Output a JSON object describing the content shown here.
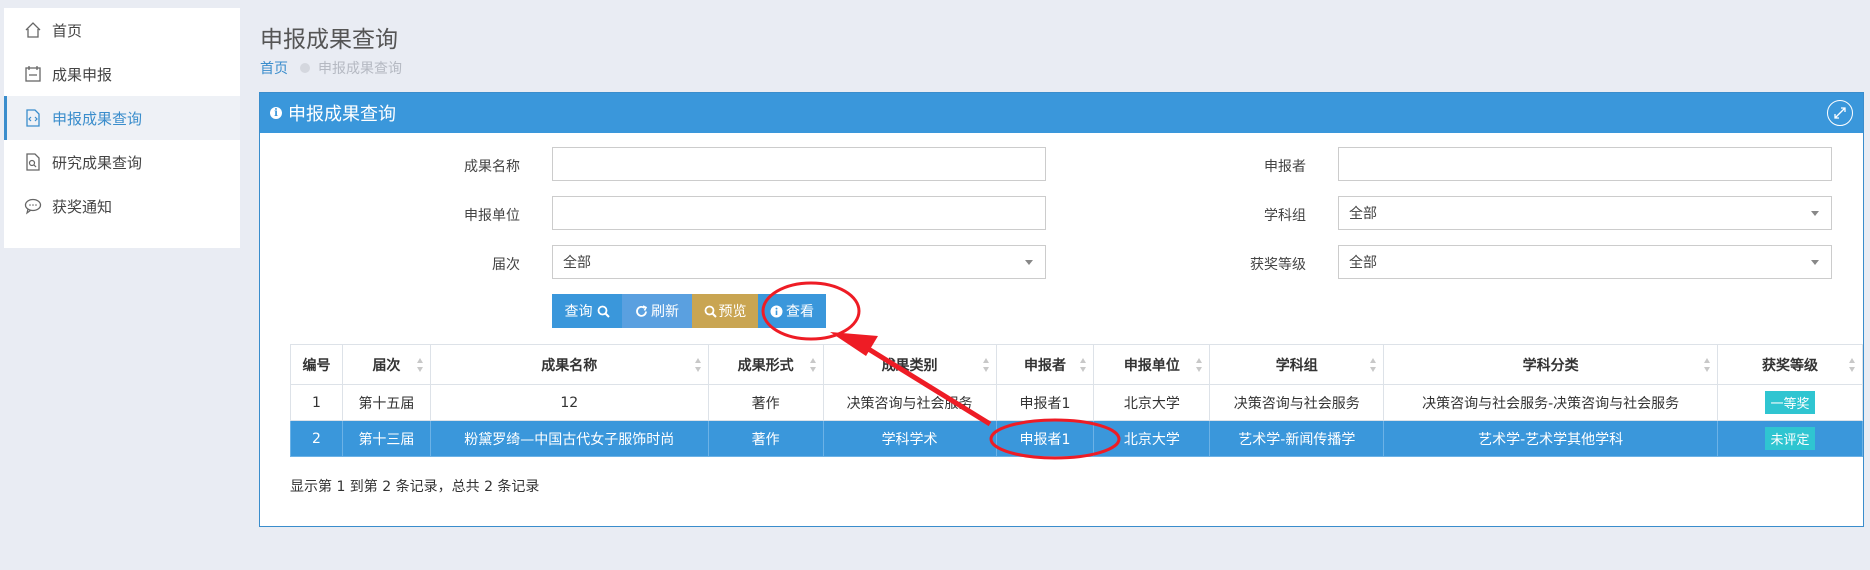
{
  "sidebar": {
    "items": [
      {
        "label": "首页",
        "icon": "home-icon"
      },
      {
        "label": "成果申报",
        "icon": "calendar-icon"
      },
      {
        "label": "申报成果查询",
        "icon": "file-code-icon",
        "active": true
      },
      {
        "label": "研究成果查询",
        "icon": "file-search-icon"
      },
      {
        "label": "获奖通知",
        "icon": "chat-icon"
      }
    ]
  },
  "header": {
    "title": "申报成果查询",
    "breadcrumb": {
      "home": "首页",
      "current": "申报成果查询"
    }
  },
  "panel": {
    "title": "申报成果查询",
    "info_glyph": "i"
  },
  "form": {
    "name_label": "成果名称",
    "name_value": "",
    "applicant_label": "申报者",
    "applicant_value": "",
    "unit_label": "申报单位",
    "unit_value": "",
    "group_label": "学科组",
    "group_value": "全部",
    "session_label": "届次",
    "session_value": "全部",
    "award_label": "获奖等级",
    "award_value": "全部"
  },
  "buttons": {
    "query": "查询",
    "refresh": "刷新",
    "preview": "预览",
    "view": "查看"
  },
  "table": {
    "headers": [
      "编号",
      "届次",
      "成果名称",
      "成果形式",
      "成果类别",
      "申报者",
      "申报单位",
      "学科组",
      "学科分类",
      "获奖等级"
    ],
    "rows": [
      {
        "cells": [
          "1",
          "第十五届",
          "12",
          "著作",
          "决策咨询与社会服务",
          "申报者1",
          "北京大学",
          "决策咨询与社会服务",
          "决策咨询与社会服务-决策咨询与社会服务"
        ],
        "award": "一等奖",
        "selected": false
      },
      {
        "cells": [
          "2",
          "第十三届",
          "粉黛罗绮—中国古代女子服饰时尚",
          "著作",
          "学科学术",
          "申报者1",
          "北京大学",
          "艺术学-新闻传播学",
          "艺术学-艺术学其他学科"
        ],
        "award": "未评定",
        "selected": true
      }
    ]
  },
  "footer": {
    "summary": "显示第 1 到第 2 条记录，总共 2 条记录"
  },
  "colors": {
    "primary": "#3a97db",
    "preview": "#c9a552",
    "badge": "#2fc5d1",
    "annotation": "#ee1c25"
  }
}
